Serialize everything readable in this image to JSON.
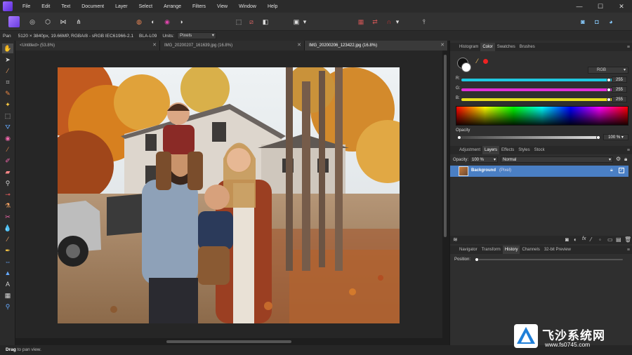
{
  "menu": {
    "items": [
      "File",
      "Edit",
      "Text",
      "Document",
      "Layer",
      "Select",
      "Arrange",
      "Filters",
      "View",
      "Window",
      "Help"
    ]
  },
  "context_bar": {
    "tool": "Pan",
    "info": "5120 × 3840px, 19.66MP, RGBA/8 - sRGB IEC61966-2.1",
    "device": "BLA-L09",
    "units_label": "Units:",
    "units_value": "Pixels"
  },
  "doc_tabs": [
    {
      "label": "<Untitled> (53.8%)",
      "active": false
    },
    {
      "label": "IMG_20200207_161639.jpg (16.8%)",
      "active": false
    },
    {
      "label": "IMG_20200206_123422.jpg (16.8%)",
      "active": true
    }
  ],
  "color_panel": {
    "tabs": [
      "Histogram",
      "Color",
      "Swatches",
      "Brushes"
    ],
    "active_tab": "Color",
    "model": "RGB",
    "r_label": "R:",
    "g_label": "G:",
    "b_label": "B:",
    "r": "255",
    "g": "255",
    "b": "255",
    "opacity_label": "Opacity",
    "opacity_value": "100 %"
  },
  "layers_panel": {
    "tabs": [
      "Adjustment",
      "Layers",
      "Effects",
      "Styles",
      "Stock"
    ],
    "active_tab": "Layers",
    "opacity_label": "Opacity:",
    "opacity_value": "100 %",
    "blend_mode": "Normal",
    "layer_name": "Background",
    "layer_type": "(Pixel)"
  },
  "history_panel": {
    "tabs": [
      "Navigator",
      "Transform",
      "History",
      "Channels",
      "32-bit Preview"
    ],
    "active_tab": "History",
    "position_label": "Position:"
  },
  "status": {
    "bold": "Drag",
    "text": " to pan view."
  },
  "watermark": {
    "brand": "飞沙系统网",
    "url": "www.fs0745.com"
  },
  "colors": {
    "accent": "#4a90d9",
    "layer_selected": "#4a7fc4"
  }
}
